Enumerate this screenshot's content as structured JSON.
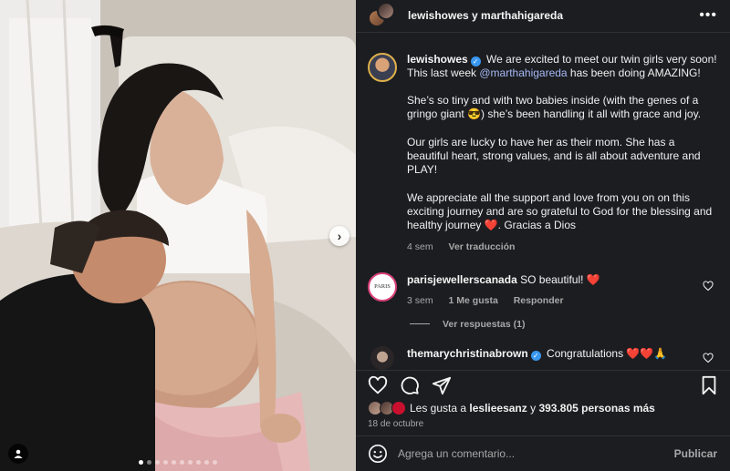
{
  "post": {
    "header": {
      "title": "lewishowes y marthahigareda",
      "more_icon": "more-horizontal-icon"
    },
    "photo": {
      "carousel_total": 10,
      "carousel_active": 1,
      "next_icon": "chevron-right-icon",
      "tag_icon": "user-tag-icon",
      "next_glyph": "›"
    },
    "caption": {
      "username": "lewishowes",
      "verified_glyph": "✓",
      "p1_before": "We are excited to meet our twin girls very soon! This last week ",
      "p1_mention": "@marthahigareda",
      "p1_after": " has been doing AMAZING!",
      "p2": "She’s so tiny and with two babies inside (with the genes of a gringo giant 😎) she’s been handling it all with grace and joy.",
      "p3": "Our girls are lucky to have her as their mom. She has a beautiful heart, strong values, and is all about adventure and PLAY!",
      "p4": "We appreciate all the support and love from you on on this exciting journey and are so grateful to God for the blessing and healthy journey ❤️. Gracias a Dios",
      "time": "4 sem",
      "translate": "Ver traducción"
    },
    "comments": [
      {
        "username": "parisjewellerscanada",
        "avatar_text": "PARIS",
        "text": "SO beautiful! ❤️",
        "time": "3 sem",
        "likes": "1 Me gusta",
        "reply": "Responder",
        "view_replies": "Ver respuestas (1)"
      },
      {
        "username": "themarychristinabrown",
        "verified_glyph": "✓",
        "text": "Congratulations ❤️❤️🙏"
      }
    ],
    "actions": {
      "like": "heart-icon",
      "comment": "comment-icon",
      "share": "share-icon",
      "save": "bookmark-icon"
    },
    "likes": {
      "prefix": "Les gusta a ",
      "user": "leslieesanz",
      "middle": " y ",
      "count": "393.805 personas más"
    },
    "date": "18 de octubre",
    "add_comment": {
      "emoji_icon": "emoji-icon",
      "placeholder": "Agrega un comentario...",
      "publish": "Publicar"
    }
  },
  "colors": {
    "panel_bg": "#1c1d21",
    "link": "#a5b8f3",
    "verified": "#3897f0",
    "muted": "#a8a8a8"
  }
}
